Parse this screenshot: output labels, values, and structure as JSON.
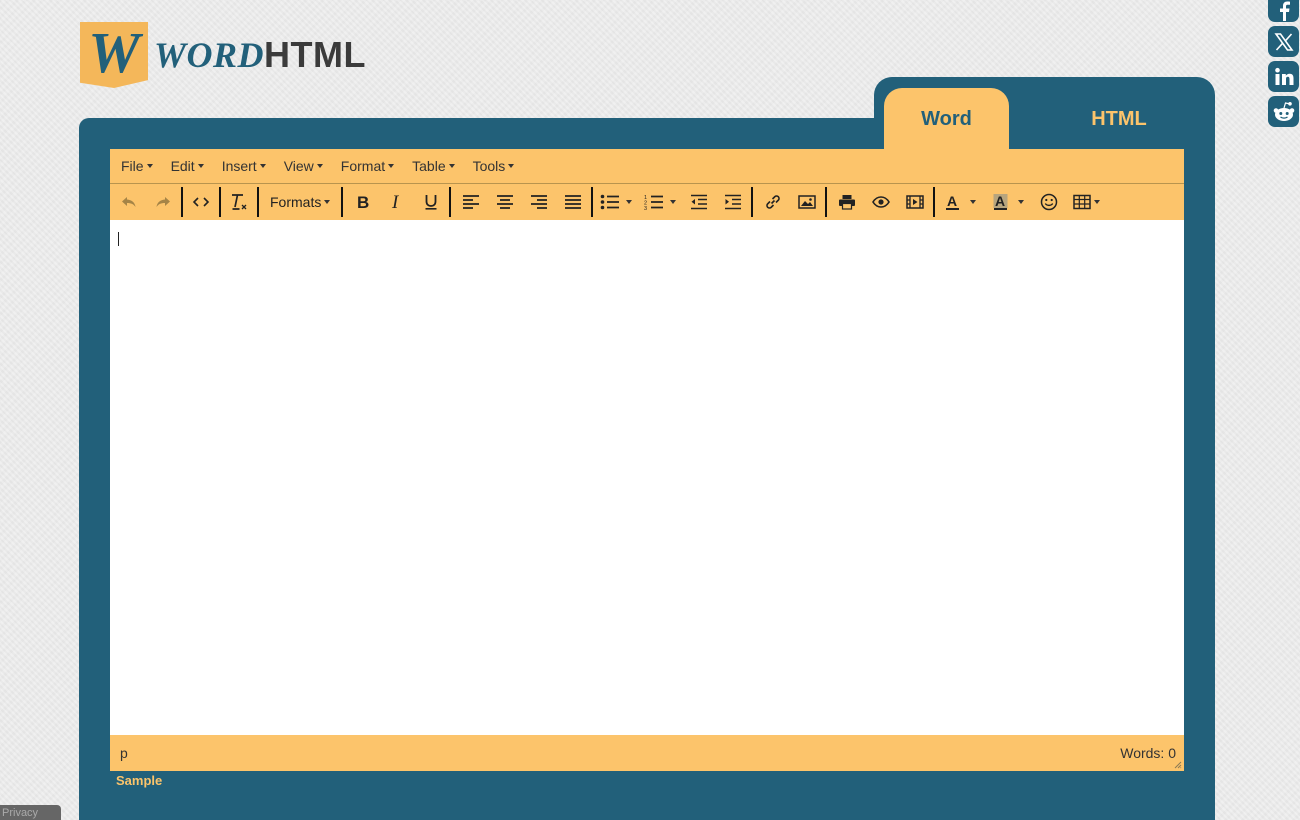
{
  "logo": {
    "letter": "W",
    "word": "WORD",
    "html": "HTML"
  },
  "social": [
    {
      "name": "facebook-icon",
      "glyph": "f"
    },
    {
      "name": "x-icon",
      "glyph": "X"
    },
    {
      "name": "linkedin-icon",
      "glyph": "in"
    },
    {
      "name": "reddit-icon",
      "glyph": "r"
    }
  ],
  "tabs": {
    "word": "Word",
    "html": "HTML"
  },
  "menubar": {
    "file": "File",
    "edit": "Edit",
    "insert": "Insert",
    "view": "View",
    "format": "Format",
    "table": "Table",
    "tools": "Tools"
  },
  "toolbar": {
    "formats_label": "Formats",
    "icons": [
      "undo-icon",
      "redo-icon",
      "source-code-icon",
      "clear-formatting-icon",
      "bold-icon",
      "italic-icon",
      "underline-icon",
      "align-left-icon",
      "align-center-icon",
      "align-right-icon",
      "justify-icon",
      "bullet-list-icon",
      "numbered-list-icon",
      "outdent-icon",
      "indent-icon",
      "link-icon",
      "image-icon",
      "print-icon",
      "preview-icon",
      "media-icon",
      "text-color-icon",
      "background-color-icon",
      "emoticons-icon",
      "table-icon"
    ]
  },
  "status": {
    "path": "p",
    "words": "Words: 0"
  },
  "sample_link": "Sample",
  "privacy": "Privacy",
  "colors": {
    "accent": "#fcc46b",
    "brand": "#22607a"
  }
}
